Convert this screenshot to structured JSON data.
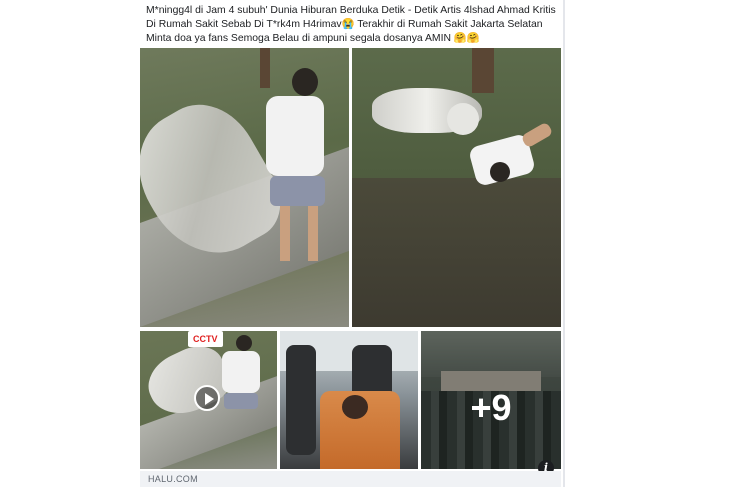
{
  "post": {
    "caption": "M*ningg4l di Jam 4 subuh' Dunia Hiburan Berduka  Detik - Detik Artis  4lshad Ahmad Kritis Di Rumah Sakit Sebab Di T*rk4m H4rimav😭 Terakhir di Rumah Sakit Jakarta Selatan Minta doa ya fans Semoga Belau di ampuni segala dosanya AMIN 🤗🤗",
    "photos": {
      "badge_cctv": "CCTV",
      "more_count": "+9"
    },
    "info_icon": "i",
    "link_domain": "HALU.COM"
  },
  "icons": [
    "play-icon",
    "info-icon"
  ],
  "colors": {
    "cctv_red": "#e02020",
    "link_bar": "#f0f2f5",
    "text": "#1c1e21"
  }
}
